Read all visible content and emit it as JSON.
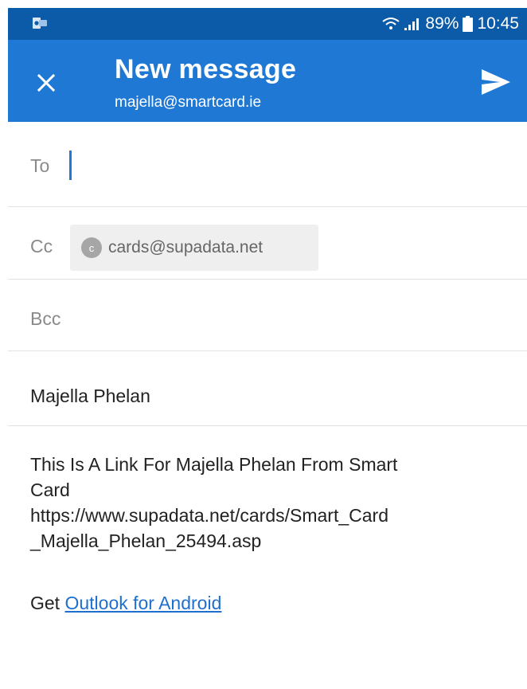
{
  "status_bar": {
    "battery": "89%",
    "time": "10:45"
  },
  "header": {
    "title": "New message",
    "account": "majella@smartcard.ie"
  },
  "fields": {
    "to_label": "To",
    "cc_label": "Cc",
    "cc_chip": {
      "avatar_letter": "c",
      "email": "cards@supadata.net"
    },
    "bcc_label": "Bcc",
    "subject": "Majella Phelan"
  },
  "body": {
    "lines": [
      "This Is A Link For Majella Phelan From Smart",
      "Card",
      "https://www.supadata.net/cards/Smart_Card",
      "_Majella_Phelan_25494.asp"
    ],
    "signature_prefix": "Get",
    "signature_link": "Outlook for Android"
  },
  "colors": {
    "status_bar": "#0b5ba8",
    "app_bar": "#1e78d4",
    "link": "#1e6fd0"
  },
  "icons": {
    "app": "outlook-app-icon",
    "wifi": "wifi-icon",
    "signal": "signal-icon",
    "battery": "battery-icon",
    "close": "close-icon",
    "send": "send-icon"
  }
}
